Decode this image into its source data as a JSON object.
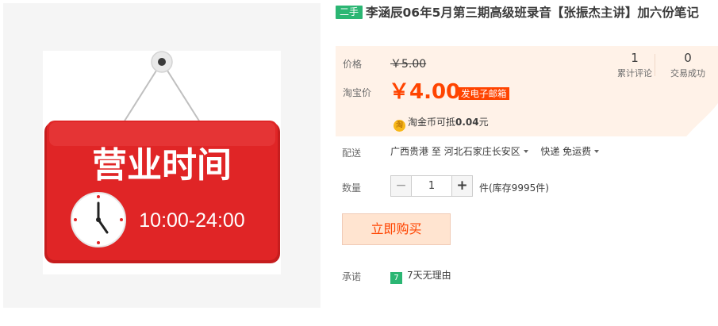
{
  "product": {
    "condition_tag": "二手",
    "title": "李涵辰06年5月第三期高级班录音【张振杰主讲】加六份笔记",
    "image": {
      "sign_text": "营业时间",
      "hours_text": "10:00-24:00",
      "sign_color": "#e02526"
    }
  },
  "price": {
    "label": "价格",
    "original": "￥5.00",
    "promo_label": "淘宝价",
    "current": "￥4.00",
    "shipping_badge": "发电子邮箱"
  },
  "stats": {
    "reviews_count": "1",
    "reviews_label": "累计评论",
    "deals_count": "0",
    "deals_label": "交易成功"
  },
  "coins": {
    "icon": "coin-icon",
    "icon_glyph": "淘",
    "text_prefix": "淘金币可抵",
    "amount": "0.04",
    "suffix": "元"
  },
  "delivery": {
    "label": "配送",
    "from": "广西贵港",
    "to_word": "至",
    "destination": "河北石家庄长安区",
    "method": "快递 免运费"
  },
  "quantity": {
    "label": "数量",
    "minus": "−",
    "value": "1",
    "plus": "+",
    "stock": "件(库存9995件)"
  },
  "actions": {
    "buy_now": "立即购买"
  },
  "promise": {
    "label": "承诺",
    "badge": "7",
    "text": "7天无理由"
  },
  "colors": {
    "accent": "#ff4400",
    "price_bg": "#fff2e8",
    "tag_green": "#2bb673"
  }
}
